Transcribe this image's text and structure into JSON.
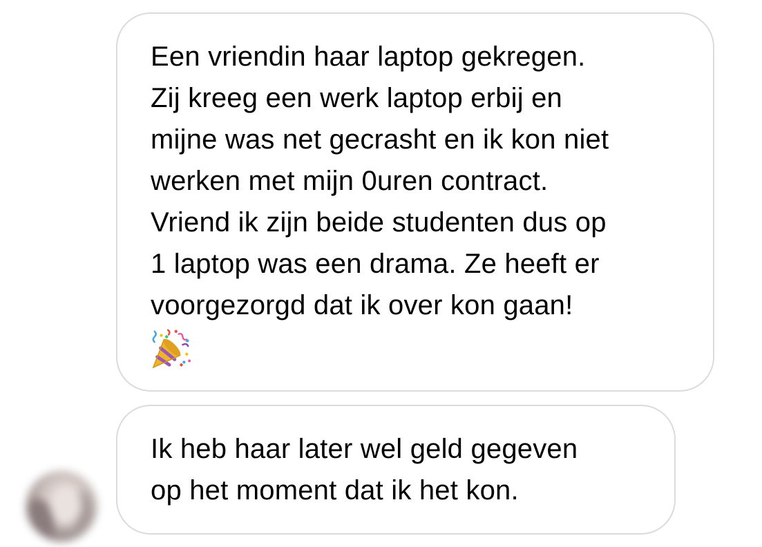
{
  "conversation": {
    "messages": [
      {
        "lines": [
          "Een vriendin haar laptop gekregen.",
          "Zij kreeg een werk laptop erbij en",
          "mijne was net gecrasht en ik kon niet",
          "werken met mijn 0uren contract.",
          "Vriend ik zijn beide studenten dus op",
          "1 laptop was een drama. Ze heeft er",
          "voorgezorgd dat ik over kon gaan!"
        ],
        "emoji": "party-popper-icon"
      },
      {
        "lines": [
          "Ik heb haar later wel geld gegeven",
          "op het moment dat ik het kon."
        ]
      }
    ],
    "sender": {
      "avatar": "blurred-profile-avatar"
    }
  },
  "colors": {
    "background": "#ffffff",
    "bubble_border": "#dbdbdb",
    "text": "#000000"
  }
}
